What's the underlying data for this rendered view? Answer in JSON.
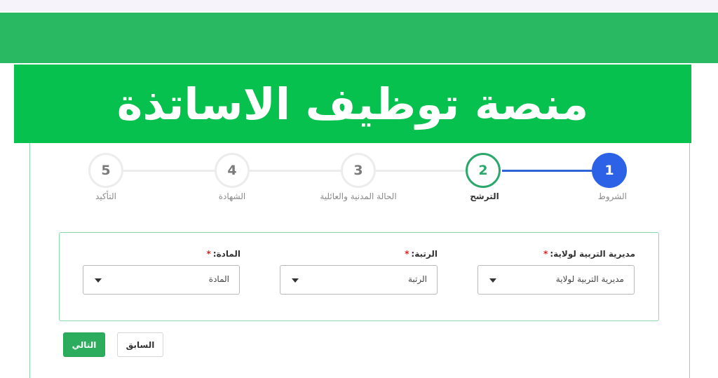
{
  "banner": {
    "title": "منصة توظيف الاساتذة"
  },
  "steps": [
    {
      "number": "1",
      "label": "الشروط",
      "state": "done"
    },
    {
      "number": "2",
      "label": "الترشح",
      "state": "current"
    },
    {
      "number": "3",
      "label": "الحالة المدنية والعائلية",
      "state": "pending"
    },
    {
      "number": "4",
      "label": "الشهادة",
      "state": "pending"
    },
    {
      "number": "5",
      "label": "التأكيد",
      "state": "pending"
    }
  ],
  "form": {
    "fields": [
      {
        "label": "مديرية التربية لولاية:",
        "required_mark": "*",
        "value": "مديرية التربية لولاية"
      },
      {
        "label": "الرتبة:",
        "required_mark": "*",
        "value": "الرتبة"
      },
      {
        "label": "المادة:",
        "required_mark": "*",
        "value": "المادة"
      }
    ]
  },
  "buttons": {
    "next": "التالي",
    "previous": "السابق"
  },
  "colors": {
    "header_green": "#29b962",
    "banner_green": "#06c14e",
    "step_done_blue": "#2d62e6",
    "step_current_green": "#2aa86b",
    "button_green": "#2bad5d",
    "required_red": "#e02020"
  },
  "icons": {
    "select_caret": "caret-down-icon"
  }
}
